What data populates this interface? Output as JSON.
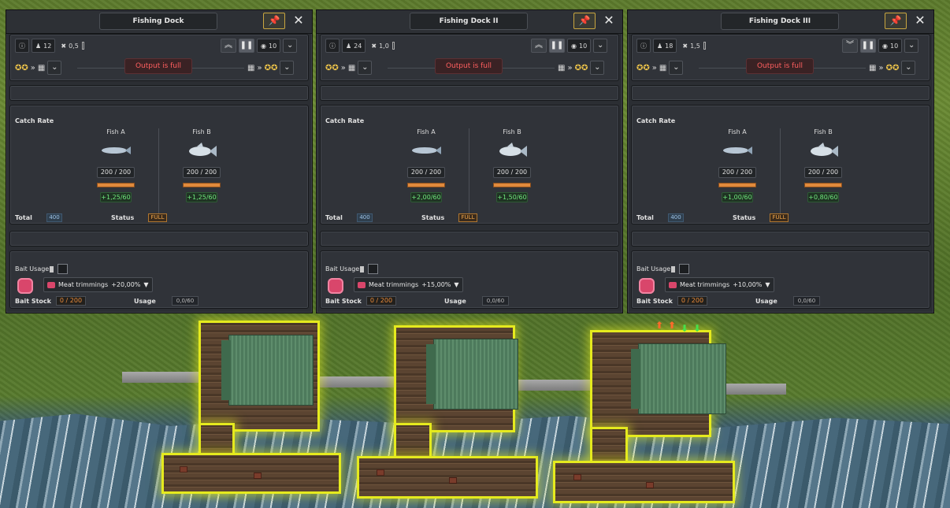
{
  "panels": [
    {
      "title": "Fishing Dock",
      "workers": "12",
      "tool_rate": "0,5",
      "priority": "10",
      "upgrade_icon": "double-chevron-up-icon",
      "status_message": "Output is full",
      "catch_rate_label": "Catch Rate",
      "fish": [
        {
          "name": "Fish A",
          "count": "200 / 200",
          "rate": "+1,25/60",
          "icon": "thin-fish-icon"
        },
        {
          "name": "Fish B",
          "count": "200 / 200",
          "rate": "+1,25/60",
          "icon": "shark-fish-icon"
        }
      ],
      "total_label": "Total",
      "total_value": "400",
      "status_label": "Status",
      "status_value": "FULL",
      "bait_usage_label": "Bait Usage",
      "bait_name": "Meat trimmings",
      "bait_bonus": "+20,00%",
      "bait_stock_label": "Bait Stock",
      "bait_stock_value": "0 / 200",
      "usage_label": "Usage",
      "usage_value": "0,0/60"
    },
    {
      "title": "Fishing Dock II",
      "workers": "24",
      "tool_rate": "1,0",
      "priority": "10",
      "upgrade_icon": "double-chevron-up-icon",
      "status_message": "Output is full",
      "catch_rate_label": "Catch Rate",
      "fish": [
        {
          "name": "Fish A",
          "count": "200 / 200",
          "rate": "+2,00/60",
          "icon": "blue-fish-icon"
        },
        {
          "name": "Fish B",
          "count": "200 / 200",
          "rate": "+1,50/60",
          "icon": "silver-fish-icon"
        }
      ],
      "total_label": "Total",
      "total_value": "400",
      "status_label": "Status",
      "status_value": "FULL",
      "bait_usage_label": "Bait Usage",
      "bait_name": "Meat trimmings",
      "bait_bonus": "+15,00%",
      "bait_stock_label": "Bait Stock",
      "bait_stock_value": "0 / 200",
      "usage_label": "Usage",
      "usage_value": "0,0/60"
    },
    {
      "title": "Fishing Dock III",
      "workers": "18",
      "tool_rate": "1,5",
      "priority": "10",
      "upgrade_icon": "double-chevron-down-icon",
      "status_message": "Output is full",
      "catch_rate_label": "Catch Rate",
      "fish": [
        {
          "name": "Fish A",
          "count": "200 / 200",
          "rate": "+1,00/60",
          "icon": "orange-fish-icon"
        },
        {
          "name": "Fish B",
          "count": "200 / 200",
          "rate": "+0,80/60",
          "icon": "small-fish-icon"
        }
      ],
      "total_label": "Total",
      "total_value": "400",
      "status_label": "Status",
      "status_value": "FULL",
      "bait_usage_label": "Bait Usage",
      "bait_name": "Meat trimmings",
      "bait_bonus": "+10,00%",
      "bait_stock_label": "Bait Stock",
      "bait_stock_value": "0 / 200",
      "usage_label": "Usage",
      "usage_value": "0,0/60"
    }
  ],
  "colors": {
    "highlight": "#e5ea1e",
    "status_red": "#ff5f5f",
    "rate_green": "#6fe77c",
    "full_orange": "#f1a64a"
  }
}
